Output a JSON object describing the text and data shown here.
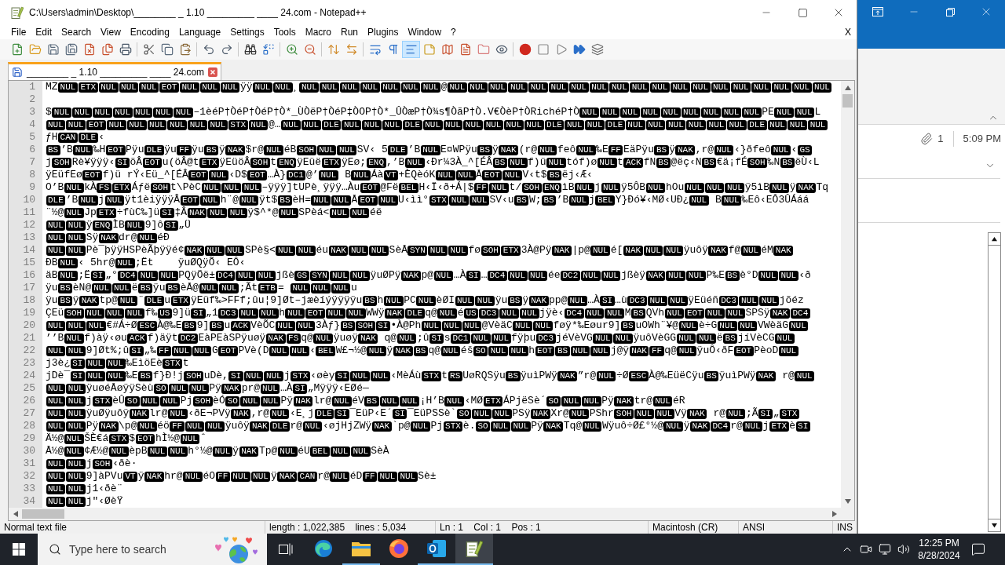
{
  "notepad": {
    "title": "C:\\Users\\admin\\Desktop\\________ _ 1.10 _________ ____ 24.com - Notepad++",
    "menu": [
      "File",
      "Edit",
      "Search",
      "View",
      "Encoding",
      "Language",
      "Settings",
      "Tools",
      "Macro",
      "Run",
      "Plugins",
      "Window",
      "?"
    ],
    "close_document": "X",
    "toolbar": [
      {
        "pressed": false
      },
      {
        "pressed": false
      },
      {
        "pressed": false
      },
      {
        "pressed": false
      },
      {
        "pressed": false
      },
      {
        "pressed": false
      },
      {
        "pressed": false
      },
      {
        "pressed": false
      },
      {
        "pressed": false
      },
      {
        "pressed": false
      },
      {
        "pressed": false
      },
      {
        "pressed": false
      },
      {
        "pressed": false
      },
      {
        "pressed": false
      },
      {
        "pressed": false
      },
      {
        "pressed": false
      },
      {
        "pressed": false
      },
      {
        "pressed": false
      },
      {
        "pressed": false
      },
      {
        "pressed": false
      },
      {
        "pressed": true
      },
      {
        "pressed": false
      },
      {
        "pressed": false
      },
      {
        "pressed": false
      },
      {
        "pressed": false
      },
      {
        "pressed": false
      },
      {
        "pressed": false
      },
      {
        "pressed": false
      },
      {
        "pressed": false
      },
      {
        "pressed": false
      },
      {
        "pressed": false
      }
    ],
    "tab": {
      "title": "________ _ 1.10 _________ ____ 24.com",
      "selected": true
    },
    "lines": [
      {
        "number": "1",
        "segments": [
          "MZ",
          [
            "NUL",
            "ETX",
            "NUL",
            "NUL",
            "NUL",
            "EOT",
            "NUL",
            "NUL",
            "NUL"
          ],
          "ÿÿ",
          [
            "NUL",
            "NUL"
          ],
          "¸",
          [
            "NUL",
            "NUL",
            "NUL",
            "NUL",
            "NUL",
            "NUL",
            "NUL"
          ],
          "@",
          [
            "NUL",
            "NUL",
            "NUL",
            "NUL",
            "NUL",
            "NUL",
            "NUL",
            "NUL",
            "NUL",
            "NUL",
            "NUL",
            "NUL",
            "NUL",
            "NUL",
            "NUL",
            "NUL",
            "NUL",
            "NUL",
            "NUL"
          ]
        ]
      },
      {
        "number": "2"
      },
      {
        "number": "3",
        "segments": [
          "$",
          [
            "NUL",
            "NUL",
            "NUL",
            "NUL",
            "NUL",
            "NUL",
            "NUL"
          ],
          "–1èéP†ÒéP†ÒéP†Ò*_ÙÒëP†ÒéP‡ÒOP†Ò*_ÛÒæP†Ò¾s¶ÒãP†Ò.V€ÒèP†ÒRichéP†Ò",
          [
            "NUL",
            "NUL",
            "NUL",
            "NUL",
            "NUL",
            "NUL",
            "NUL",
            "NUL",
            "NUL"
          ],
          "PE",
          [
            "NUL",
            "NUL"
          ],
          "L"
        ]
      },
      {
        "number": "4",
        "segments": [
          [
            "NUL",
            "NUL",
            "EOT",
            "NUL",
            "NUL",
            "NUL",
            "NUL",
            "NUL",
            "NUL",
            "STX",
            "NUL"
          ],
          "@…",
          [
            "NUL",
            "NUL",
            "DLE",
            "NUL",
            "NUL",
            "NUL",
            "DLE",
            "NUL",
            "NUL",
            "NUL",
            "NUL",
            "NUL",
            "NUL",
            "DLE",
            "NUL",
            "NUL",
            "DLE",
            "NUL",
            "NUL",
            "NUL",
            "NUL",
            "NUL",
            "NUL",
            "DLE",
            "NUL",
            "NUL",
            "NUL"
          ]
        ]
      },
      {
        "number": "5",
        "segments": [
          "ƒH",
          [
            "CAN",
            "DLE"
          ],
          "‹"
        ]
      },
      {
        "number": "6",
        "segments": [
          [
            "BS"
          ],
          "’B",
          [
            "NUL"
          ],
          "‰H",
          [
            "EOT"
          ],
          "Pÿu",
          [
            "DLE"
          ],
          "ÿu",
          [
            "FF"
          ],
          "ÿu",
          [
            "BS"
          ],
          "ÿ",
          [
            "NAK"
          ],
          "$r@",
          [
            "NUL"
          ],
          "éB",
          [
            "SOH",
            "NUL",
            "NUL"
          ],
          "SV‹ 5",
          [
            "DLE"
          ],
          "’B",
          [
            "NUL"
          ],
          "E¤WPÿu",
          [
            "BS"
          ],
          "ÿ",
          [
            "NAK"
          ],
          "(r@",
          [
            "NUL"
          ],
          "feô",
          [
            "NUL"
          ],
          "‰E",
          [
            "FF"
          ],
          "EäPÿu",
          [
            "BS"
          ],
          "ÿ",
          [
            "NAK"
          ],
          ",r@",
          [
            "NUL"
          ],
          "‹}ðfeô",
          [
            "NUL"
          ],
          "‹",
          [
            "GS"
          ]
        ]
      },
      {
        "number": "7",
        "segments": [
          "j",
          [
            "SOH"
          ],
          "Rè¥ÿÿÿ‹",
          [
            "SI"
          ],
          "öÂ",
          [
            "EOT"
          ],
          "u(öÂ@t",
          [
            "ETX"
          ],
          "ÿEüöÂ",
          [
            "SOH"
          ],
          "t",
          [
            "ENQ"
          ],
          "ÿEüë",
          [
            "ETX"
          ],
          "ÿEø;",
          [
            "ENQ"
          ],
          ",’B",
          [
            "NUL"
          ],
          "‹Ðr¼3À_^[ÉÂ",
          [
            "BS",
            "NUL"
          ],
          "f)ü",
          [
            "NUL"
          ],
          "tóf)ø",
          [
            "NUL"
          ],
          "t",
          [
            "ACK"
          ],
          "fN",
          [
            "BS"
          ],
          "@ëç‹N",
          [
            "BS"
          ],
          "€ä¡fÉ",
          [
            "SOH"
          ],
          "‰N",
          [
            "BS"
          ],
          "ëÙ‹L"
        ]
      },
      {
        "number": "8",
        "segments": [
          "ÿEüfEø",
          [
            "EOT"
          ],
          "f)ü rÝ‹Eü_^[ÉÂ",
          [
            "EOT",
            "NUL"
          ],
          "‹D$",
          [
            "EOT"
          ],
          "…À}",
          [
            "DC1"
          ],
          "@’",
          [
            "NUL"
          ],
          " B",
          [
            "NUL"
          ],
          "Áà",
          [
            "VT"
          ],
          "+ÈQèóK",
          [
            "NUL",
            "NUL"
          ],
          "Å",
          [
            "EOT",
            "NUL"
          ],
          "V‹t$",
          [
            "BS"
          ],
          "ëj‹Æ‹"
        ]
      },
      {
        "number": "9",
        "segments": [
          "O’B",
          [
            "NUL"
          ],
          "kÀ",
          [
            "FS",
            "ETX"
          ],
          "Áƒë",
          [
            "SOH"
          ],
          "t\\PèC",
          [
            "NUL",
            "NUL",
            "NUL"
          ],
          "–ÿÿÿ]tUPè¸ÿÿÿ…Àu",
          [
            "EOT"
          ],
          "@Fë",
          [
            "BEL"
          ],
          "H‹Ï‹ð+Á|$",
          [
            "FF",
            "NUL"
          ],
          "t/",
          [
            "SOH",
            "ENQ"
          ],
          "ìB",
          [
            "NUL"
          ],
          "j",
          [
            "NUL"
          ],
          "ÿ5ÔB",
          [
            "NUL"
          ],
          "hOu",
          [
            "NUL",
            "NUL",
            "NUL"
          ],
          "ÿ5ìB",
          [
            "NUL"
          ],
          "ÿ",
          [
            "NAK"
          ],
          "Tq"
        ]
      },
      {
        "number": "10",
        "segments": [
          [
            "DLE"
          ],
          "’B",
          [
            "NUL"
          ],
          "j",
          [
            "NUL"
          ],
          "ÿt1èiÿÿÿÂ",
          [
            "EOT",
            "NUL"
          ],
          "h¨@",
          [
            "NUL"
          ],
          "ÿt$",
          [
            "BS"
          ],
          "èH=",
          [
            "NUL",
            "NUL"
          ],
          "Å",
          [
            "EOT",
            "NUL"
          ],
          "U‹ìì°",
          [
            "STX",
            "NUL",
            "NUL"
          ],
          "SV‹u",
          [
            "BS"
          ],
          "W;",
          [
            "BS"
          ],
          "’B",
          [
            "NUL"
          ],
          "j",
          [
            "BEL"
          ],
          "Y}Ðó¥‹MØ‹UÐ¿",
          [
            "NUL"
          ],
          " B",
          [
            "NUL"
          ],
          "‰Eô‹EÔ3ÛÁáá"
        ]
      },
      {
        "number": "11",
        "segments": [
          "¨½@",
          [
            "NUL"
          ],
          "Jp",
          [
            "ETX"
          ],
          "÷fùC‰]ü",
          [
            "SI"
          ],
          "‡Â",
          [
            "NAK",
            "NUL",
            "NUL"
          ],
          "ÿ$^*@",
          [
            "NUL"
          ],
          "SPèá<",
          [
            "NUL",
            "NUL"
          ],
          "éë"
        ]
      },
      {
        "number": "12",
        "segments": [
          [
            "NUL",
            "NUL"
          ],
          "ÿ",
          [
            "ENQ"
          ],
          "ÌB",
          [
            "NUL"
          ],
          "9]ô",
          [
            "SI"
          ],
          "„Ü"
        ]
      },
      {
        "number": "13",
        "segments": [
          [
            "NUL",
            "NUL"
          ],
          "Sÿ",
          [
            "NAK"
          ],
          "dr@",
          [
            "NUL"
          ],
          "éÐ"
        ]
      },
      {
        "number": "14",
        "segments": [
          [
            "NUL",
            "NUL"
          ],
          "Pè¯þÿÿHSPèÃþÿÿé¢",
          [
            "NAK",
            "NUL",
            "NUL"
          ],
          "SPè§<",
          [
            "NUL",
            "NUL"
          ],
          "éu",
          [
            "NAK",
            "NUL",
            "NUL"
          ],
          "SèÅ",
          [
            "SYN",
            "NUL",
            "NUL"
          ],
          "fø",
          [
            "SOH",
            "ETX"
          ],
          "3À@Pÿ",
          [
            "NAK"
          ],
          "|p@",
          [
            "NUL"
          ],
          "é[",
          [
            "NAK",
            "NUL",
            "NUL"
          ],
          "ÿuôÿ",
          [
            "NAK"
          ],
          "f@",
          [
            "NUL"
          ],
          "éM",
          [
            "NAK"
          ]
        ]
      },
      {
        "number": "15",
        "segments": [
          "ÐB",
          [
            "NUL"
          ],
          "‹ 5hr@",
          [
            "NUL"
          ],
          ";Ët    ÿuØQÿÕ‹ EÔ‹"
        ]
      },
      {
        "number": "16",
        "segments": [
          "äB",
          [
            "NUL"
          ],
          ";Ë",
          [
            "SI"
          ],
          "„°",
          [
            "DC4",
            "NUL",
            "NUL"
          ],
          "PQÿÖë±",
          [
            "DC4",
            "NUL",
            "NUL"
          ],
          "jßè",
          [
            "GS",
            "SYN",
            "NUL",
            "NUL"
          ],
          "ÿuØPÿ",
          [
            "NAK"
          ],
          "p@",
          [
            "NUL"
          ],
          "…À",
          [
            "SI"
          ],
          "…",
          [
            "DC4",
            "NUL",
            "NUL"
          ],
          "ée",
          [
            "DC2",
            "NUL",
            "NUL"
          ],
          "jßèÿ",
          [
            "NAK",
            "NUL",
            "NUL"
          ],
          "P‰E",
          [
            "BS"
          ],
          "è°D",
          [
            "NUL",
            "NUL"
          ],
          "‹ð"
        ]
      },
      {
        "number": "17",
        "segments": [
          "ÿu",
          [
            "BS"
          ],
          "èN@",
          [
            "NUL",
            "NUL"
          ],
          "ë",
          [
            "BS"
          ],
          "ÿu",
          [
            "BS"
          ],
          "èÅ@",
          [
            "NUL",
            "NUL"
          ],
          ";Ãt",
          [
            "ETB"
          ],
          "= ",
          [
            "NUL",
            "NUL",
            "NUL"
          ],
          "u"
        ]
      },
      {
        "number": "18",
        "segments": [
          "ÿu",
          [
            "BS"
          ],
          "ÿ",
          [
            "NAK"
          ],
          "tp@",
          [
            "NUL"
          ],
          "¨",
          [
            "DLE"
          ],
          "u",
          [
            "ETX"
          ],
          "ÿEüf‰>FFf;ûu¦9]Øt–jæèíýÿÿÿÿu",
          [
            "BS"
          ],
          "h",
          [
            "NUL"
          ],
          "PC",
          [
            "NUL"
          ],
          "èØI",
          [
            "NUL",
            "NUL"
          ],
          "ÿu",
          [
            "BS"
          ],
          "ÿ",
          [
            "NAK"
          ],
          "pp@",
          [
            "NUL"
          ],
          "…À",
          [
            "SI"
          ],
          "…ù",
          [
            "DC3",
            "NUL",
            "NUL"
          ],
          "ÿEüéñ",
          [
            "DC3",
            "NUL",
            "NUL"
          ],
          "jõéz"
        ]
      },
      {
        "number": "19",
        "segments": [
          "ÇEü",
          [
            "SOH",
            "NUL",
            "NUL",
            "NUL"
          ],
          "f‰",
          [
            "US"
          ],
          "9]ü",
          [
            "SI"
          ],
          "„1",
          [
            "DC3",
            "NUL",
            "NUL"
          ],
          "h",
          [
            "NUL",
            "EOT",
            "NUL",
            "NUL"
          ],
          "WWÿ",
          [
            "NAK",
            "DLE"
          ],
          "q@",
          [
            "NUL"
          ],
          "é",
          [
            "US",
            "DC3",
            "NUL",
            "NUL"
          ],
          "jÿè‹",
          [
            "DC4",
            "NUL",
            "NUL"
          ],
          "M",
          [
            "BS"
          ],
          "QVh",
          [
            "NUL",
            "EOT",
            "NUL",
            "NUL"
          ],
          "SPSÿ",
          [
            "NAK",
            "DC4"
          ]
        ]
      },
      {
        "number": "20",
        "segments": [
          [
            "NUL",
            "NUL",
            "NUL"
          ],
          "€#Á÷Ø",
          [
            "ESC"
          ],
          "À@‰E",
          [
            "BS"
          ],
          "9]",
          [
            "BS"
          ],
          "u",
          [
            "ACK"
          ],
          "VèÕC",
          [
            "NUL",
            "NUL"
          ],
          "3Àƒ}",
          [
            "BS",
            "SOH",
            "SI"
          ],
          "•À@Ph",
          [
            "NUL",
            "NUL",
            "NUL"
          ],
          "@VèäC",
          [
            "NUL",
            "NUL"
          ],
          "føÿ*‰Eøur9]",
          [
            "BS"
          ],
          "uOWh¨¥@",
          [
            "NUL"
          ],
          "è÷G",
          [
            "NUL",
            "NUL"
          ],
          "VWèäG",
          [
            "NUL"
          ]
        ]
      },
      {
        "number": "21",
        "segments": [
          "’’B",
          [
            "NUL"
          ],
          "f)àÿ‹øu",
          [
            "ACK"
          ],
          "f)äÿt",
          [
            "DC2"
          ],
          "EàPEàSPÿuøÿ",
          [
            "NAK",
            "FS"
          ],
          "q@",
          [
            "NUL"
          ],
          "ÿuøÿ",
          [
            "NAK"
          ],
          " q@",
          [
            "NUL"
          ],
          ";û",
          [
            "SI"
          ],
          "s",
          [
            "DC1",
            "NUL",
            "NUL"
          ],
          "fÿþu",
          [
            "DC3"
          ],
          "jéVèVG",
          [
            "NUL",
            "NUL"
          ],
          "ÿuôVèGG",
          [
            "NUL",
            "NUL"
          ],
          "ë",
          [
            "BS"
          ],
          "jíVèCG",
          [
            "NUL"
          ]
        ]
      },
      {
        "number": "22",
        "segments": [
          [
            "NUL",
            "NUL"
          ],
          "9]Øt%;û",
          [
            "SI"
          ],
          "„‰",
          [
            "FF",
            "NUL",
            "NUL"
          ],
          "G",
          [
            "EOT"
          ],
          "PVè(D",
          [
            "NUL",
            "NUL"
          ],
          "‹",
          [
            "BEL"
          ],
          "W£¬½@",
          [
            "NUL"
          ],
          "ÿ",
          [
            "NAK",
            "BS"
          ],
          "q@",
          [
            "NUL"
          ],
          "éš",
          [
            "SO",
            "NUL",
            "NUL"
          ],
          "h",
          [
            "EOT",
            "BS",
            "NUL",
            "NUL"
          ],
          "j@ÿ",
          [
            "NAK",
            "FF"
          ],
          "q@",
          [
            "NUL"
          ],
          "ÿuÔ‹ðF",
          [
            "EOT"
          ],
          "PèoD",
          [
            "NUL"
          ]
        ]
      },
      {
        "number": "23",
        "segments": [
          "j3è¿",
          [
            "SI",
            "NUL",
            "NUL"
          ],
          "‰EìöEè",
          [
            "STX"
          ],
          "t"
        ]
      },
      {
        "number": "24",
        "segments": [
          "jDè¯",
          [
            "SI",
            "NUL",
            "NUL"
          ],
          "‰E",
          [
            "BS"
          ],
          "f}Ð!j",
          [
            "SOH"
          ],
          "uDè,",
          [
            "SI",
            "NUL",
            "NUL"
          ],
          "j",
          [
            "STX"
          ],
          "‹øèy",
          [
            "SI",
            "NUL",
            "NUL"
          ],
          "‹MèÁù",
          [
            "STX"
          ],
          "t",
          [
            "RS"
          ],
          "UøRQSÿu",
          [
            "BS"
          ],
          "ÿuìPWÿ",
          [
            "NAK"
          ],
          "”r@",
          [
            "NUL"
          ],
          "÷Ø",
          [
            "ESC"
          ],
          "À@‰EüëCÿu",
          [
            "BS"
          ],
          "ÿuìPWÿ",
          [
            "NAK"
          ],
          " r@",
          [
            "NUL"
          ]
        ]
      },
      {
        "number": "25",
        "segments": [
          [
            "NUL",
            "NUL"
          ],
          "ÿuøéÅøÿÿSèù",
          [
            "SO",
            "NUL",
            "NUL"
          ],
          "Pÿ",
          [
            "NAK"
          ],
          "pr@",
          [
            "NUL"
          ],
          "…À",
          [
            "SI"
          ],
          "„Mÿÿÿ‹EØé—"
        ]
      },
      {
        "number": "26",
        "segments": [
          [
            "NUL",
            "NUL"
          ],
          "j",
          [
            "STX"
          ],
          "èÛ",
          [
            "SO",
            "NUL",
            "NUL"
          ],
          "Pj",
          [
            "SOH"
          ],
          "èÓ",
          [
            "SO",
            "NUL",
            "NUL"
          ],
          "Pÿ",
          [
            "NAK"
          ],
          "lr@",
          [
            "NUL"
          ],
          "éV",
          [
            "BS",
            "NUL",
            "NUL"
          ],
          "¡H’B",
          [
            "NUL"
          ],
          "‹MØ",
          [
            "ETX"
          ],
          "ÁPjëSè´",
          [
            "SO",
            "NUL",
            "NUL"
          ],
          "Pÿ",
          [
            "NAK"
          ],
          "tr@",
          [
            "NUL"
          ],
          "éR"
        ]
      },
      {
        "number": "27",
        "segments": [
          [
            "NUL",
            "NUL"
          ],
          "ÿuØÿuôÿ",
          [
            "NAK"
          ],
          "lr@",
          [
            "NUL"
          ],
          "‹ðE¬PVÿ",
          [
            "NAK"
          ],
          ",r@",
          [
            "NUL"
          ],
          "‹E¸j",
          [
            "DLE",
            "SI"
          ],
          "¯EüP‹E´",
          [
            "SI"
          ],
          "¯EüPSSè`",
          [
            "SO",
            "NUL",
            "NUL"
          ],
          "PSÿ",
          [
            "NAK"
          ],
          "Xr@",
          [
            "NUL"
          ],
          "PShr",
          [
            "SOH",
            "NUL",
            "NUL"
          ],
          "Vÿ",
          [
            "NAK"
          ],
          " r@",
          [
            "NUL"
          ],
          ";Ã",
          [
            "SI"
          ],
          "„",
          [
            "STX"
          ]
        ]
      },
      {
        "number": "28",
        "segments": [
          [
            "NUL",
            "NUL"
          ],
          "Pÿ",
          [
            "NAK"
          ],
          "\\p@",
          [
            "NUL"
          ],
          "éö",
          [
            "FF",
            "NUL",
            "NUL"
          ],
          "ÿuôÿ",
          [
            "NAK",
            "DLE"
          ],
          "r@",
          [
            "NUL"
          ],
          "‹øjHjZWÿ",
          [
            "NAK"
          ],
          "`p@",
          [
            "NUL"
          ],
          "Pj",
          [
            "STX"
          ],
          "è.",
          [
            "SO",
            "NUL",
            "NUL"
          ],
          "Pÿ",
          [
            "NAK"
          ],
          "Tq@",
          [
            "NUL"
          ],
          "Wÿuô÷Ø£°½@",
          [
            "NUL"
          ],
          "ÿ",
          [
            "NAK",
            "DC4"
          ],
          "r@",
          [
            "NUL"
          ],
          "j",
          [
            "ETX"
          ],
          "è",
          [
            "SI"
          ]
        ]
      },
      {
        "number": "29",
        "segments": [
          "Ä½@",
          [
            "NUL"
          ],
          "ŠÈ€á",
          [
            "STX"
          ],
          "$",
          [
            "EOT"
          ],
          "hÌ½@",
          [
            "NUL"
          ],
          "ˆ"
        ]
      },
      {
        "number": "30",
        "segments": [
          "Å½@",
          [
            "NUL"
          ],
          "¢Æ½@",
          [
            "NUL"
          ],
          "èpB",
          [
            "NUL",
            "NUL"
          ],
          "h°½@",
          [
            "NUL"
          ],
          "ÿ",
          [
            "NAK"
          ],
          "Tp@",
          [
            "NUL"
          ],
          "éU",
          [
            "BEL",
            "NUL",
            "NUL"
          ],
          "SèÀ"
        ]
      },
      {
        "number": "31",
        "segments": [
          [
            "NUL",
            "NUL"
          ],
          "j",
          [
            "SOH"
          ],
          "‹ðè·"
        ]
      },
      {
        "number": "32",
        "segments": [
          [
            "NUL",
            "NUL"
          ],
          "9]àPVu",
          [
            "VT"
          ],
          "ÿ",
          [
            "NAK"
          ],
          "hr@",
          [
            "NUL"
          ],
          "éO",
          [
            "FF",
            "NUL",
            "NUL"
          ],
          "ÿ",
          [
            "NAK",
            "CAN"
          ],
          "r@",
          [
            "NUL"
          ],
          "éD",
          [
            "FF",
            "NUL",
            "NUL"
          ],
          "Sè±"
        ]
      },
      {
        "number": "33",
        "segments": [
          [
            "NUL",
            "NUL"
          ],
          "j1‹ðè¨"
        ]
      },
      {
        "number": "34",
        "segments": [
          [
            "NUL",
            "NUL"
          ],
          "j\"‹ØèŸ"
        ]
      }
    ],
    "status_bar": [
      "Normal text file",
      "length : 1,022,385    lines : 5,034",
      "Ln : 1    Col : 1    Pos : 1",
      "Macintosh (CR)",
      "ANSI",
      "INS"
    ]
  },
  "outlook": {
    "attachment_count": "1",
    "time": "5:09 PM"
  },
  "taskbar": {
    "search": {
      "placeholder": "Type here to search"
    },
    "apps": [
      {
        "running": false,
        "active": false
      },
      {
        "running": true,
        "active": false
      },
      {
        "running": false,
        "active": false
      },
      {
        "running": true,
        "active": false
      },
      {
        "running": true,
        "active": true
      }
    ],
    "time": "12:25 PM",
    "date": "8/28/2024"
  }
}
